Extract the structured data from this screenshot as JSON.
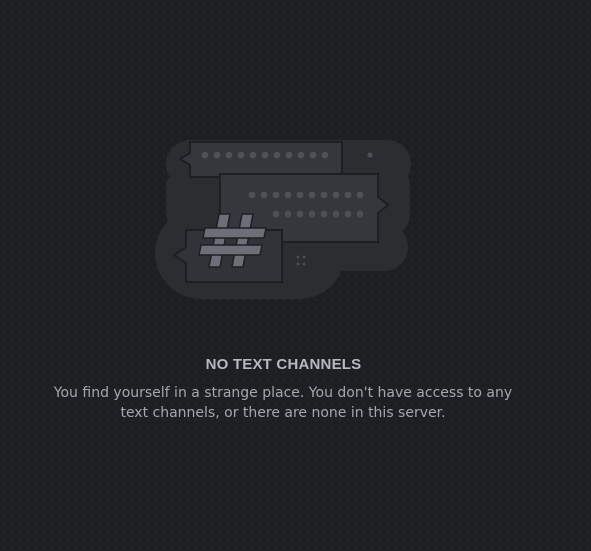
{
  "empty_state": {
    "illustration_icon": "hashtag-channels-illustration",
    "title": "NO TEXT CHANNELS",
    "description": "You find yourself in a strange place. You don't have access to any text channels, or there are none in this server."
  },
  "colors": {
    "background": "#1e1f22",
    "illustration_base": "#2b2d31",
    "illustration_card": "#35373c",
    "illustration_detail": "#4e5058",
    "title_text": "#b5bac1",
    "body_text": "#a4a8ae"
  }
}
